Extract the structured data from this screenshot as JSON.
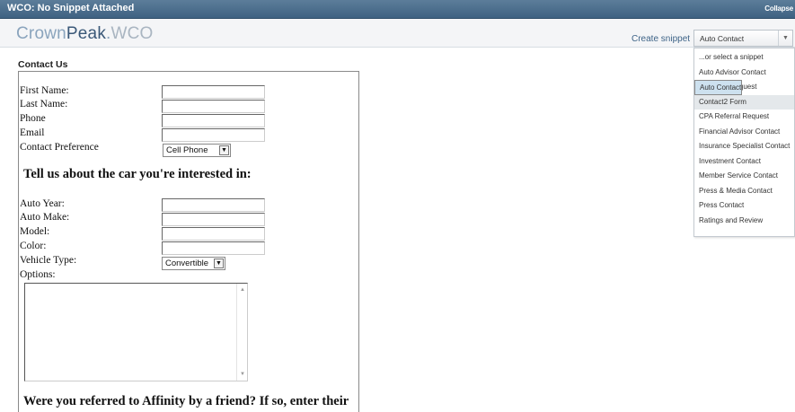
{
  "topbar": {
    "title": "WCO: No Snippet Attached",
    "collapse": "Collapse"
  },
  "header": {
    "logo": {
      "crown": "Crown",
      "peak": "Peak",
      "dot": ".",
      "wco": "WCO"
    },
    "create_snippet": "Create snippet",
    "snippet_select": {
      "value": "Auto Contact",
      "arrow_icon": "chevron-down-icon"
    }
  },
  "dropdown": {
    "options": [
      "...or select a snippet",
      "Auto Advisor Contact",
      "Auto Contact",
      "Business Request",
      "Contact2 Form",
      "CPA Referral Request",
      "Financial Advisor Contact",
      "Insurance Specialist Contact",
      "Investment Contact",
      "Member Service Contact",
      "Press & Media Contact",
      "Press Contact",
      "Ratings and Review"
    ],
    "selected": "Auto Contact",
    "highlighted": "Contact2 Form"
  },
  "form": {
    "panel_title": "Contact Us",
    "labels": {
      "first_name": "First Name:",
      "last_name": "Last Name:",
      "phone": "Phone",
      "email": "Email",
      "contact_preference": "Contact Preference",
      "auto_year": "Auto Year:",
      "auto_make": "Auto Make:",
      "model": "Model:",
      "color": "Color:",
      "vehicle_type": "Vehicle Type:",
      "options": "Options:"
    },
    "contact_preference_value": "Cell Phone",
    "vehicle_type_value": "Convertible",
    "heading_car": "Tell us about the car you're interested in:",
    "heading_referral": "Were you referred to Affinity by a friend? If so, enter their",
    "values": {
      "first_name": "",
      "last_name": "",
      "phone": "",
      "email": "",
      "auto_year": "",
      "auto_make": "",
      "model": "",
      "color": "",
      "options": ""
    }
  },
  "colors": {
    "topbar": "#4a6d8c",
    "accent": "#3d6387",
    "selected_option": "#cde1ef"
  }
}
